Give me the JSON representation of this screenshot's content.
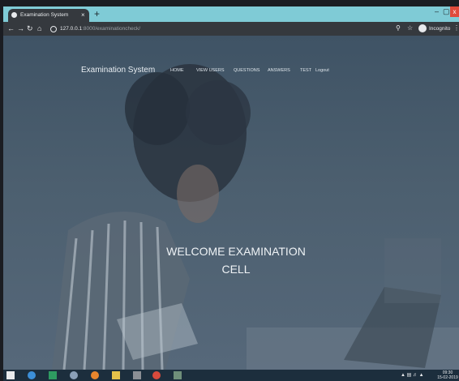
{
  "browser": {
    "tab_title": "Examination System",
    "tab_close": "×",
    "new_tab": "+",
    "window_minimize": "–",
    "window_maximize": "▢",
    "window_close": "x",
    "url_host": "127.0.0.1",
    "url_rest": ":8000/examinationcheck/",
    "incognito_label": "Incognito"
  },
  "navbar": {
    "brand": "Examination System",
    "items": [
      "HOME",
      "VIEW USERS",
      "QUESTIONS",
      "ANSWERS",
      "TEST",
      "Logout"
    ]
  },
  "hero": {
    "line1": "WELCOME EXAMINATION",
    "line2": "CELL"
  },
  "taskbar": {
    "time": "09:30",
    "date": "15-02-2019"
  }
}
